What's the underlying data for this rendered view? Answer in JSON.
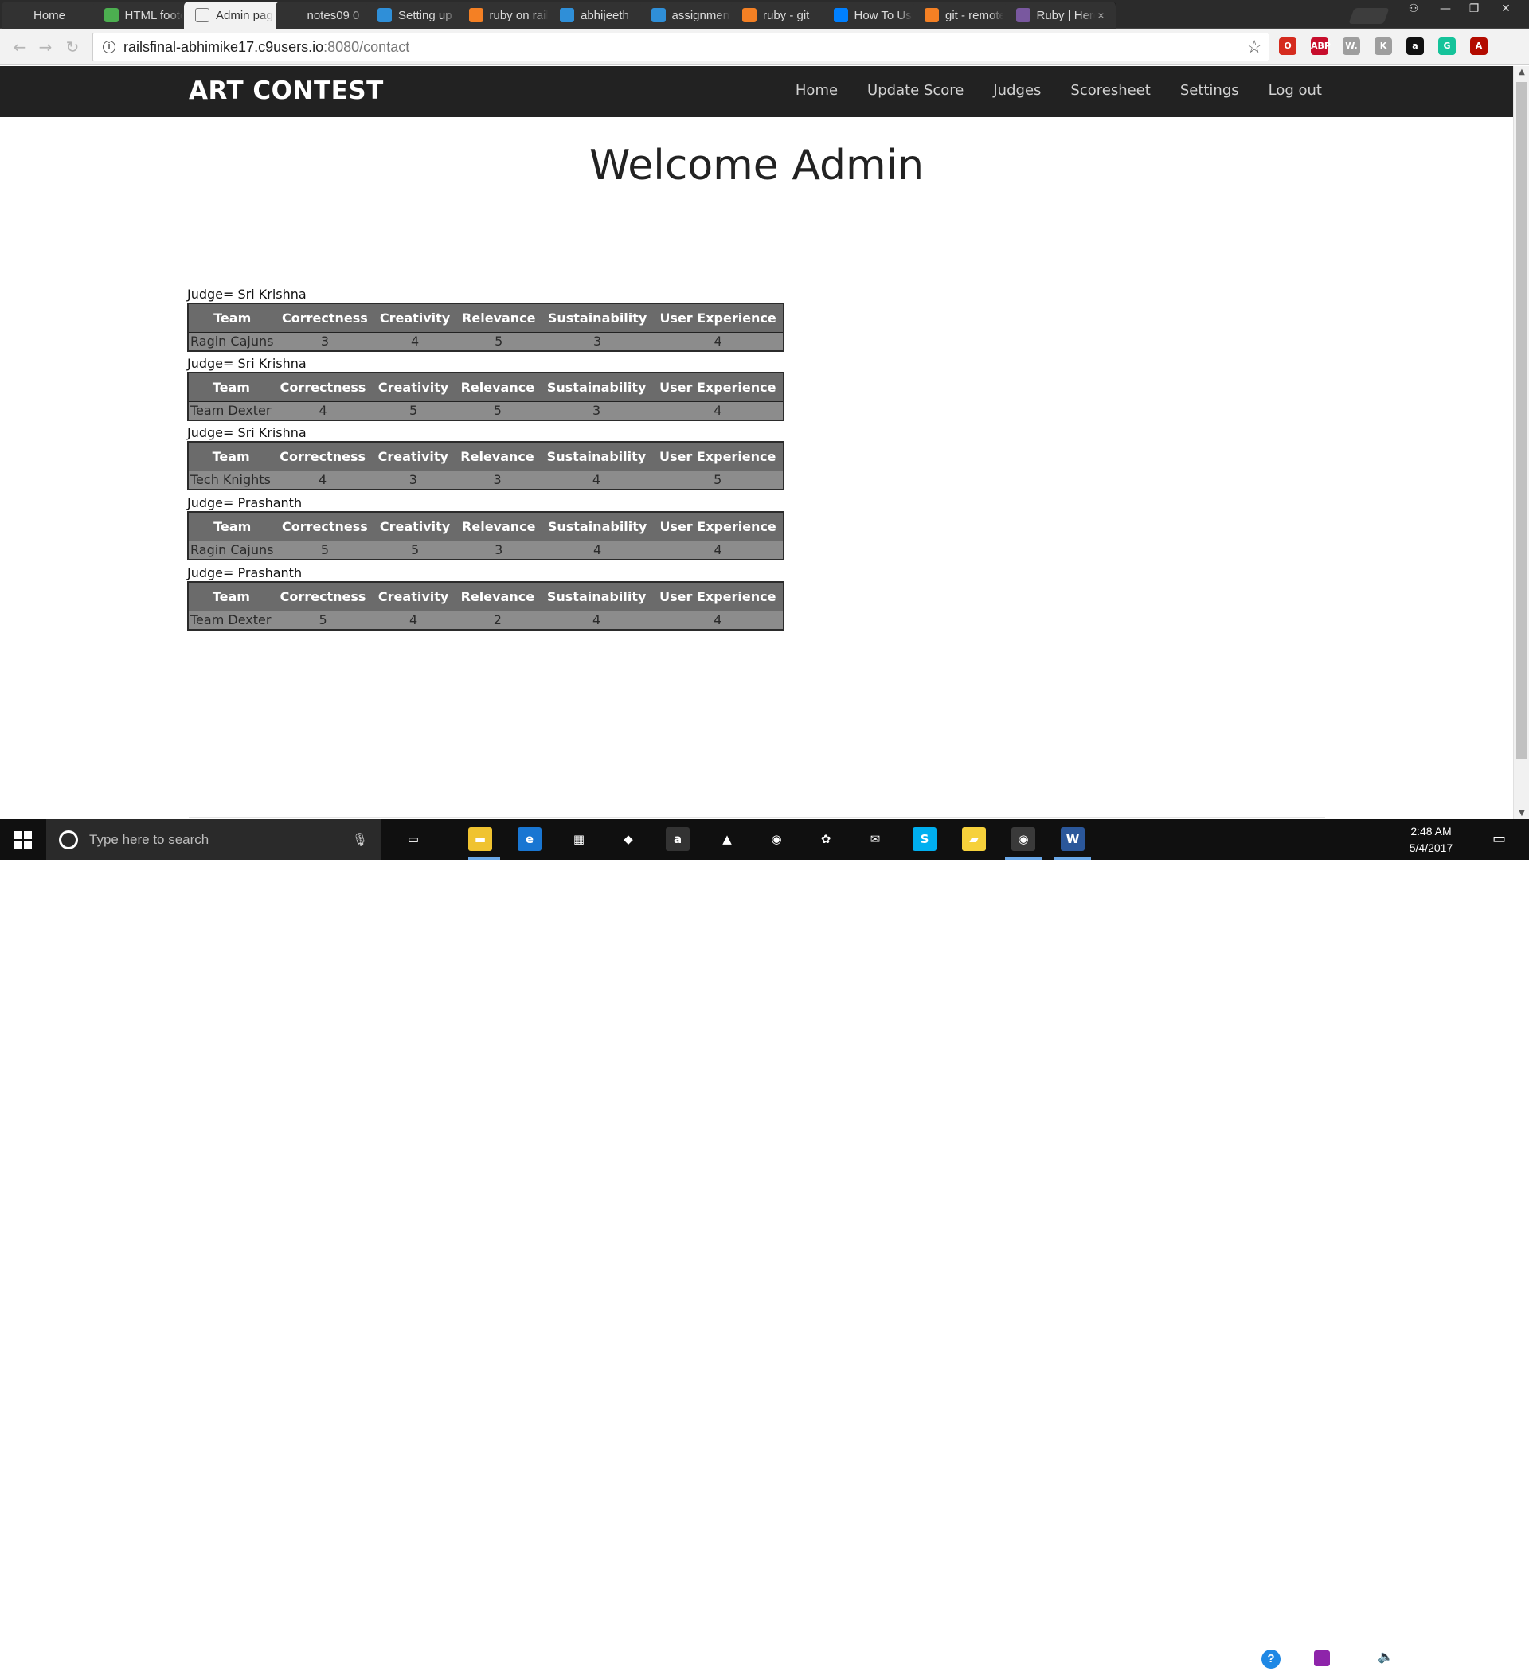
{
  "browser": {
    "tabs": [
      {
        "title": "Home",
        "icon": "blank-page-icon",
        "color": "#323232"
      },
      {
        "title": "HTML footer",
        "icon": "w3schools-icon",
        "color": "#4caf50"
      },
      {
        "title": "Admin page",
        "icon": "document-icon",
        "color": "#f2f2f2",
        "active": true
      },
      {
        "title": "notes09 0",
        "icon": "document-icon",
        "color": "#323232"
      },
      {
        "title": "Setting up",
        "icon": "cloud9-icon",
        "color": "#2f8fd8"
      },
      {
        "title": "ruby on rails",
        "icon": "stackoverflow-icon",
        "color": "#f48024"
      },
      {
        "title": "abhijeeth",
        "icon": "cloud9-icon",
        "color": "#2f8fd8"
      },
      {
        "title": "assignment",
        "icon": "cloud9-icon",
        "color": "#2f8fd8"
      },
      {
        "title": "ruby - git",
        "icon": "stackoverflow-icon",
        "color": "#f48024"
      },
      {
        "title": "How To Use",
        "icon": "digitalocean-icon",
        "color": "#0080ff"
      },
      {
        "title": "git - remote",
        "icon": "stackoverflow-icon",
        "color": "#f48024"
      },
      {
        "title": "Ruby | Heroku",
        "icon": "heroku-icon",
        "color": "#79589f"
      }
    ],
    "url_host": "railsfinal-abhimike17.c9users.io",
    "url_path": ":8080/contact",
    "extensions": [
      {
        "name": "opera-vpn-icon",
        "label": "O",
        "color": "#d52b1e"
      },
      {
        "name": "adblock-plus-icon",
        "label": "ABP",
        "color": "#c70d2c"
      },
      {
        "name": "wordtune-icon",
        "label": "W.",
        "color": "#9e9e9e"
      },
      {
        "name": "keep-icon",
        "label": "K",
        "color": "#9e9e9e"
      },
      {
        "name": "amazon-assistant-icon",
        "label": "a",
        "color": "#111111"
      },
      {
        "name": "grammarly-icon",
        "label": "G",
        "color": "#15c39a"
      },
      {
        "name": "acrobat-icon",
        "label": "A",
        "color": "#b30b00"
      }
    ]
  },
  "site": {
    "brand": "ART CONTEST",
    "nav": [
      "Home",
      "Update Score",
      "Judges",
      "Scoresheet",
      "Settings",
      "Log out"
    ],
    "heading": "Welcome Admin"
  },
  "scores": {
    "columns": [
      "Team",
      "Correctness",
      "Creativity",
      "Relevance",
      "Sustainability",
      "User Experience"
    ],
    "entries": [
      {
        "judge_label": "Judge= Sri Krishna",
        "team": "Ragin Cajuns",
        "values": [
          "3",
          "4",
          "5",
          "3",
          "4"
        ]
      },
      {
        "judge_label": "Judge= Sri Krishna",
        "team": "Team Dexter",
        "values": [
          "4",
          "5",
          "5",
          "3",
          "4"
        ]
      },
      {
        "judge_label": "Judge= Sri Krishna",
        "team": "Tech Knights",
        "values": [
          "4",
          "3",
          "3",
          "4",
          "5"
        ]
      },
      {
        "judge_label": "Judge= Prashanth",
        "team": "Ragin Cajuns",
        "values": [
          "5",
          "5",
          "3",
          "4",
          "4"
        ]
      },
      {
        "judge_label": "Judge= Prashanth",
        "team": "Team Dexter",
        "values": [
          "5",
          "4",
          "2",
          "4",
          "4"
        ]
      }
    ]
  },
  "taskbar": {
    "search_placeholder": "Type here to search",
    "apps": [
      {
        "name": "task-view-icon",
        "label": "▭",
        "color": "#101010"
      },
      {
        "name": "file-explorer-icon",
        "label": "▬",
        "color": "#f0c330"
      },
      {
        "name": "edge-icon",
        "label": "e",
        "color": "#1976d2"
      },
      {
        "name": "store-icon",
        "label": "▦",
        "color": "#101010"
      },
      {
        "name": "dropbox-icon",
        "label": "◆",
        "color": "#101010"
      },
      {
        "name": "amazon-icon",
        "label": "a",
        "color": "#333333"
      },
      {
        "name": "vlc-icon",
        "label": "▲",
        "color": "#101010"
      },
      {
        "name": "chrome-icon",
        "label": "◉",
        "color": "#101010"
      },
      {
        "name": "paint-icon",
        "label": "✿",
        "color": "#101010"
      },
      {
        "name": "mail-icon",
        "label": "✉",
        "color": "#101010"
      },
      {
        "name": "skype-icon",
        "label": "S",
        "color": "#00aff0"
      },
      {
        "name": "sticky-notes-icon",
        "label": "▰",
        "color": "#f6d13b"
      },
      {
        "name": "chrome-active-icon",
        "label": "◉",
        "color": "#3a3a3a"
      },
      {
        "name": "word-icon",
        "label": "W",
        "color": "#2b579a"
      }
    ],
    "time": "2:48 AM",
    "date": "5/4/2017"
  }
}
